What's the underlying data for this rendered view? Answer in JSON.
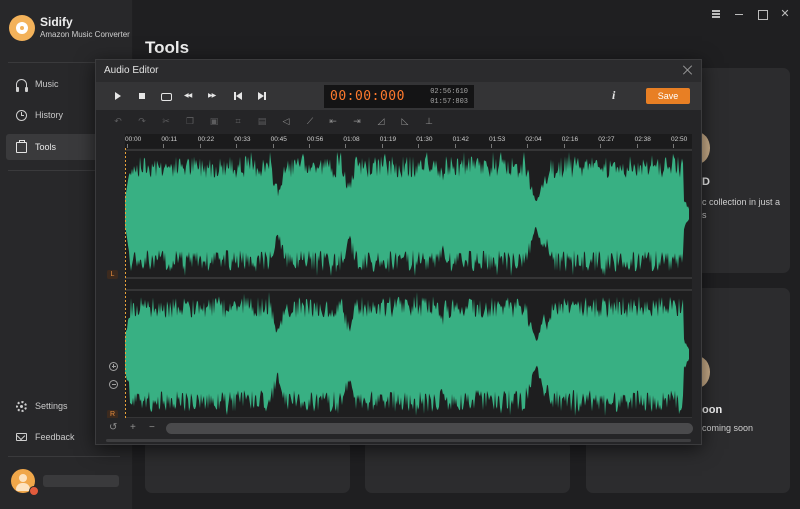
{
  "app": {
    "name": "Sidify",
    "subtitle": "Amazon Music Converter"
  },
  "sidebar": {
    "items": [
      {
        "label": "Music",
        "icon": "headphones-icon"
      },
      {
        "label": "History",
        "icon": "clock-icon"
      },
      {
        "label": "Tools",
        "icon": "toolbox-icon",
        "active": true
      }
    ],
    "bottom_items": [
      {
        "label": "Settings",
        "icon": "gear-icon"
      },
      {
        "label": "Feedback",
        "icon": "mail-icon"
      }
    ]
  },
  "page": {
    "title": "Tools",
    "card_partial_1": {
      "title": "D",
      "desc_line1": "c collection in just a",
      "desc_line2": "s"
    },
    "card_partial_2": {
      "title": "oon",
      "desc": "coming soon"
    }
  },
  "editor": {
    "title": "Audio Editor",
    "time_current": "00:00:000",
    "time_total": "02:56:610",
    "time_selection": "01:57:803",
    "info_label": "i",
    "save_label": "Save",
    "channel_left": "L",
    "channel_right": "R",
    "ruler_ticks": [
      "00:00",
      "00:11",
      "00:22",
      "00:33",
      "00:45",
      "00:56",
      "01:08",
      "01:19",
      "01:30",
      "01:42",
      "01:53",
      "02:04",
      "02:16",
      "02:27",
      "02:38",
      "02:50"
    ]
  },
  "colors": {
    "accent": "#e87f24",
    "waveform": "#38b083",
    "time_display": "#ff7a2d"
  }
}
